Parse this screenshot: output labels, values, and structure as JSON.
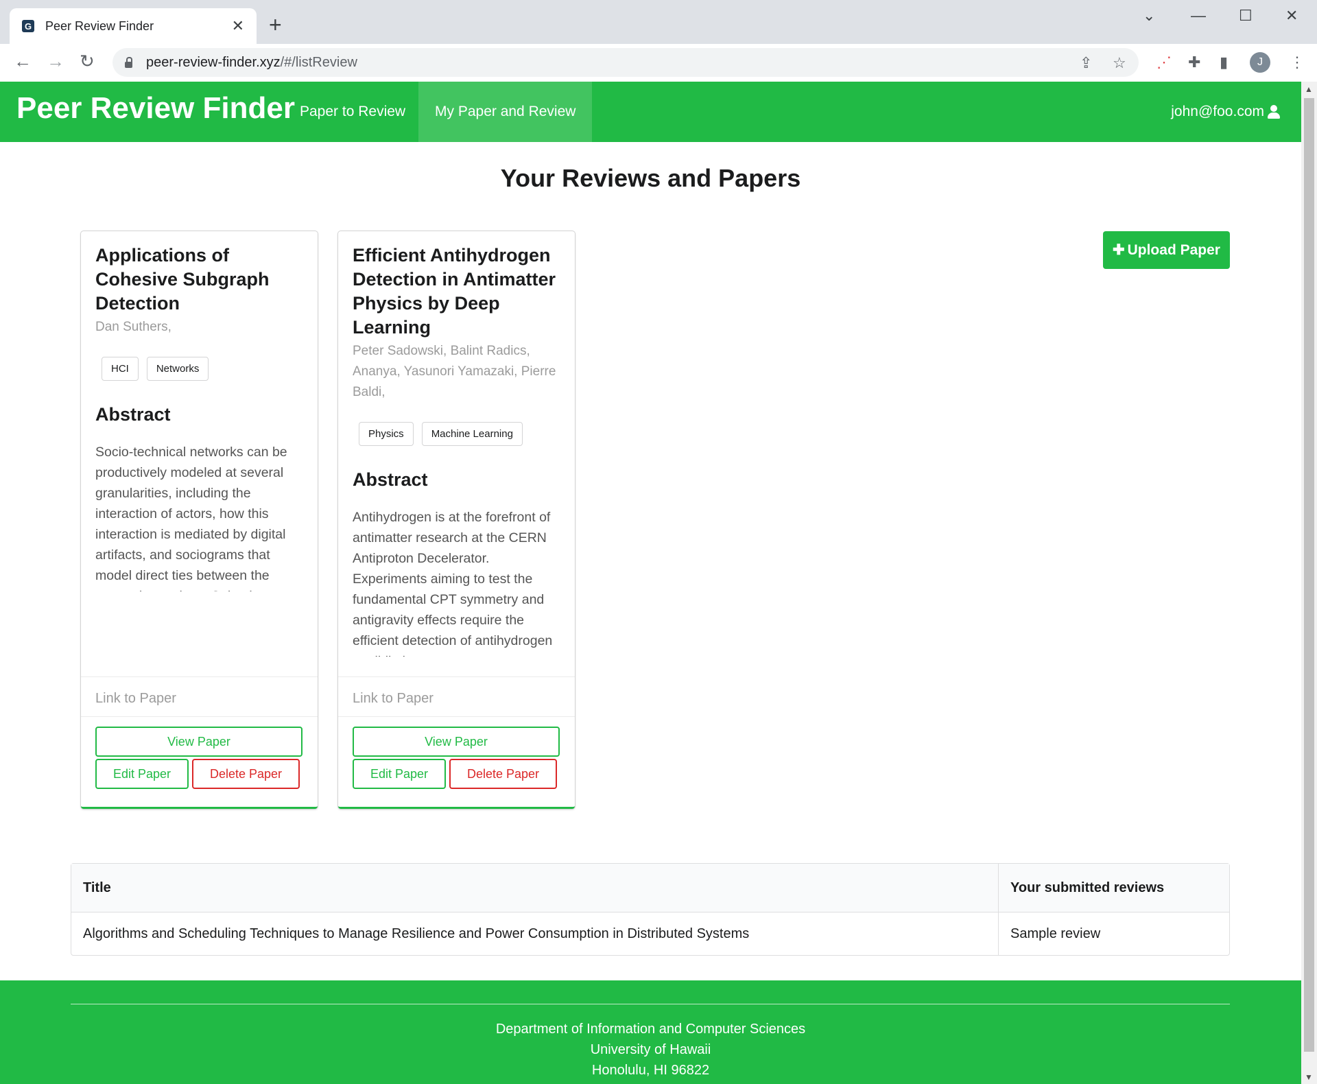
{
  "browser": {
    "tab_title": "Peer Review Finder",
    "url_domain": "peer-review-finder.xyz",
    "url_path": "/#/listReview",
    "profile_initial": "J"
  },
  "navbar": {
    "brand": "Peer Review Finder",
    "items": [
      {
        "label": "Paper to Review",
        "active": false
      },
      {
        "label": "My Paper and Review",
        "active": true
      }
    ],
    "user_email": "john@foo.com"
  },
  "page": {
    "title": "Your Reviews and Papers",
    "upload_label": "Upload Paper"
  },
  "cards": [
    {
      "title": "Applications of Cohesive Subgraph Detection",
      "authors": "Dan Suthers,",
      "tags": [
        "HCI",
        "Networks"
      ],
      "abstract_heading": "Abstract",
      "abstract": "Socio-technical networks can be productively modeled at several granularities, including the interaction of actors, how this interaction is mediated by digital artifacts, and sociograms that model direct ties between the actors themselves. Cohesive",
      "link_label": "Link to Paper",
      "view_label": "View Paper",
      "edit_label": "Edit Paper",
      "delete_label": "Delete Paper"
    },
    {
      "title": "Efficient Antihydrogen Detection in Antimatter Physics by Deep Learning",
      "authors": "Peter Sadowski, Balint Radics, Ananya, Yasunori Yamazaki, Pierre Baldi,",
      "tags": [
        "Physics",
        "Machine Learning"
      ],
      "abstract_heading": "Abstract",
      "abstract": "Antihydrogen is at the forefront of antimatter research at the CERN Antiproton Decelerator. Experiments aiming to test the fundamental CPT symmetry and antigravity effects require the efficient detection of antihydrogen annihilation",
      "link_label": "Link to Paper",
      "view_label": "View Paper",
      "edit_label": "Edit Paper",
      "delete_label": "Delete Paper"
    }
  ],
  "reviews_table": {
    "headers": [
      "Title",
      "Your submitted reviews"
    ],
    "rows": [
      [
        "Algorithms and Scheduling Techniques to Manage Resilience and Power Consumption in Distributed Systems",
        "Sample review"
      ]
    ]
  },
  "footer": {
    "lines": [
      "Department of Information and Computer Sciences",
      "University of Hawaii",
      "Honolulu, HI 96822"
    ]
  },
  "colors": {
    "brand_green": "#21ba45",
    "delete_red": "#db2828"
  }
}
